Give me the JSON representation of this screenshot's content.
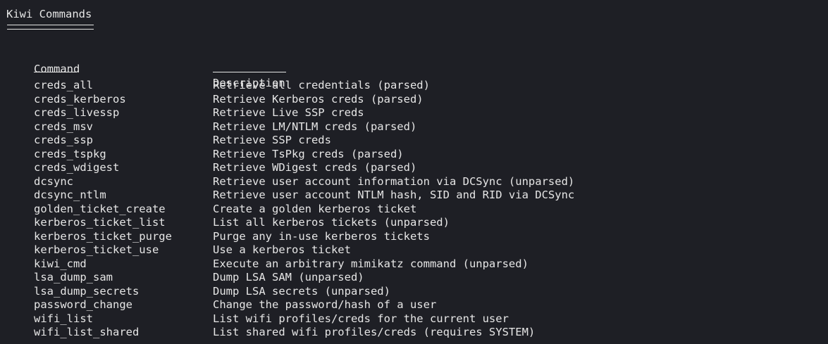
{
  "title": "Kiwi Commands",
  "headers": {
    "command": "Command",
    "description": "Description"
  },
  "rows": [
    {
      "command": "creds_all",
      "description": "Retrieve all credentials (parsed)"
    },
    {
      "command": "creds_kerberos",
      "description": "Retrieve Kerberos creds (parsed)"
    },
    {
      "command": "creds_livessp",
      "description": "Retrieve Live SSP creds"
    },
    {
      "command": "creds_msv",
      "description": "Retrieve LM/NTLM creds (parsed)"
    },
    {
      "command": "creds_ssp",
      "description": "Retrieve SSP creds"
    },
    {
      "command": "creds_tspkg",
      "description": "Retrieve TsPkg creds (parsed)"
    },
    {
      "command": "creds_wdigest",
      "description": "Retrieve WDigest creds (parsed)"
    },
    {
      "command": "dcsync",
      "description": "Retrieve user account information via DCSync (unparsed)"
    },
    {
      "command": "dcsync_ntlm",
      "description": "Retrieve user account NTLM hash, SID and RID via DCSync"
    },
    {
      "command": "golden_ticket_create",
      "description": "Create a golden kerberos ticket"
    },
    {
      "command": "kerberos_ticket_list",
      "description": "List all kerberos tickets (unparsed)"
    },
    {
      "command": "kerberos_ticket_purge",
      "description": "Purge any in-use kerberos tickets"
    },
    {
      "command": "kerberos_ticket_use",
      "description": "Use a kerberos ticket"
    },
    {
      "command": "kiwi_cmd",
      "description": "Execute an arbitrary mimikatz command (unparsed)"
    },
    {
      "command": "lsa_dump_sam",
      "description": "Dump LSA SAM (unparsed)"
    },
    {
      "command": "lsa_dump_secrets",
      "description": "Dump LSA secrets (unparsed)"
    },
    {
      "command": "password_change",
      "description": "Change the password/hash of a user"
    },
    {
      "command": "wifi_list",
      "description": "List wifi profiles/creds for the current user"
    },
    {
      "command": "wifi_list_shared",
      "description": "List shared wifi profiles/creds (requires SYSTEM)"
    }
  ]
}
